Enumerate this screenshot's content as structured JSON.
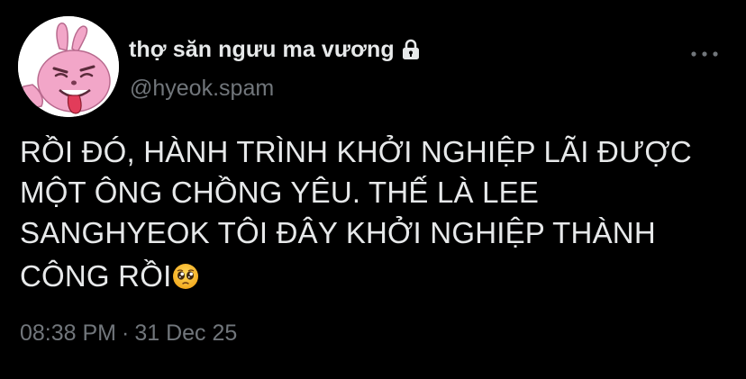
{
  "tweet": {
    "author": {
      "display_name": "thợ săn ngưu ma vương",
      "handle": "@hyeok.spam",
      "avatar_icon": "pink-rabbit-tongue-out-avatar",
      "protected_icon": "lock-icon"
    },
    "more_icon": "more-horizontal-icon",
    "text_lines": [
      "RỒI ĐÓ, HÀNH TRÌNH KHỞI NGHIỆP LÃI ĐƯỢC",
      "MỘT ÔNG CHỒNG YÊU. THẾ LÀ LEE",
      "SANGHYEOK TÔI ĐÂY KHỞI NGHIỆP THÀNH",
      "CÔNG RỒI"
    ],
    "trailing_emoji": "pleading-face-icon",
    "time": "08:38 PM",
    "separator": "·",
    "date": "31 Dec 25"
  },
  "colors": {
    "background": "#000000",
    "text_primary": "#e7e9ea",
    "text_secondary": "#71767b",
    "avatar_pink": "#f2a6c8"
  }
}
